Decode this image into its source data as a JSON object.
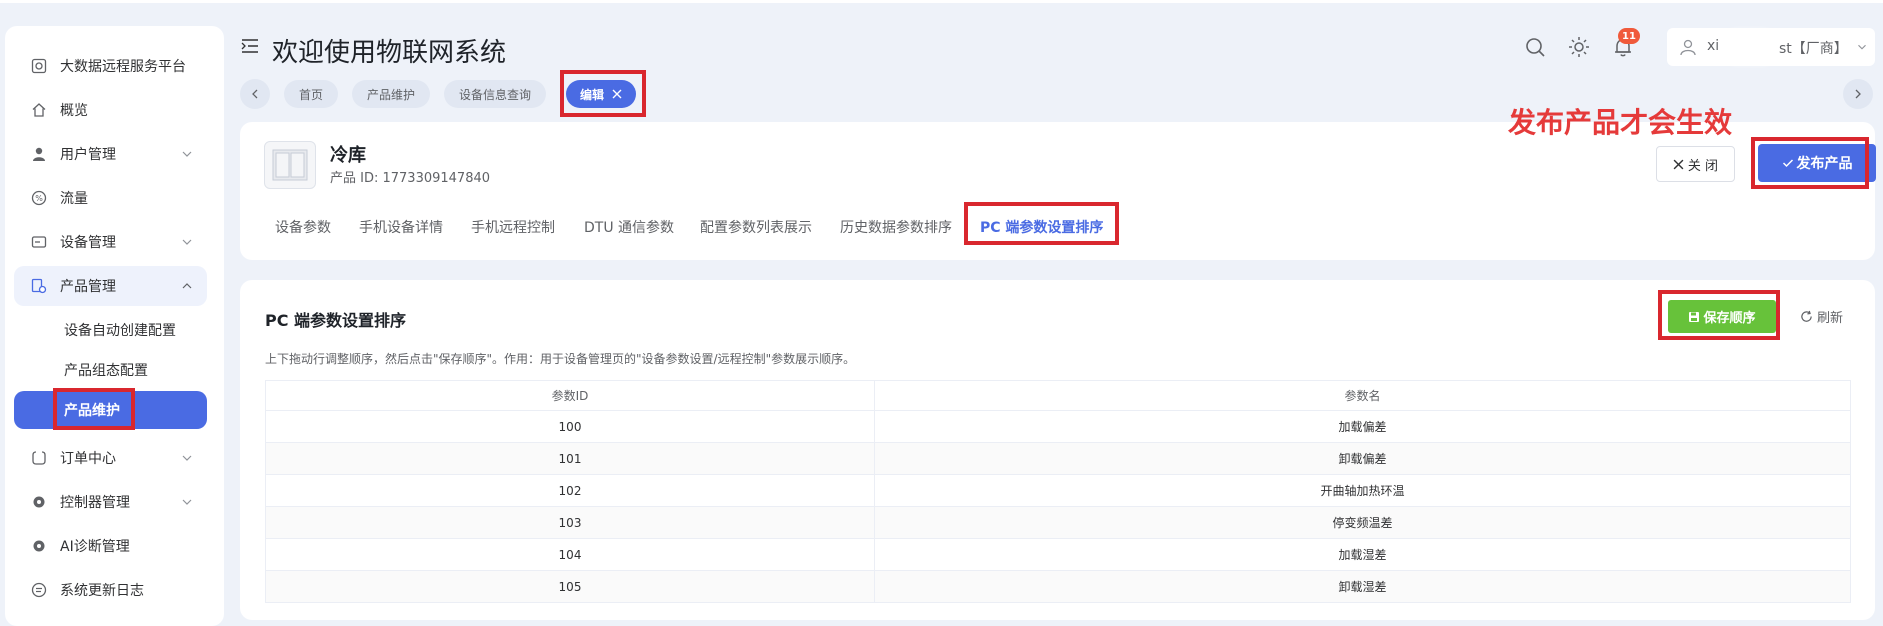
{
  "header": {
    "title": "欢迎使用物联网系统",
    "notification_count": "11",
    "user_name_start": "xi",
    "user_name_end": "st【厂商】"
  },
  "sidebar": {
    "items": [
      {
        "label": "大数据远程服务平台",
        "icon": "platform-icon"
      },
      {
        "label": "概览",
        "icon": "home-icon"
      },
      {
        "label": "用户管理",
        "icon": "user-icon"
      },
      {
        "label": "流量",
        "icon": "percent-icon"
      },
      {
        "label": "设备管理",
        "icon": "device-icon"
      },
      {
        "label": "产品管理",
        "icon": "product-icon"
      },
      {
        "label": "订单中心",
        "icon": "order-icon"
      },
      {
        "label": "控制器管理",
        "icon": "gear-icon"
      },
      {
        "label": "AI诊断管理",
        "icon": "gear-icon"
      },
      {
        "label": "系统更新日志",
        "icon": "log-icon"
      }
    ],
    "product_sub": [
      "设备自动创建配置",
      "产品组态配置",
      "产品维护"
    ]
  },
  "tabs": [
    {
      "label": "首页"
    },
    {
      "label": "产品维护"
    },
    {
      "label": "设备信息查询"
    },
    {
      "label": "编辑"
    }
  ],
  "product": {
    "name": "冷库",
    "id_text": "产品 ID:  1773309147840",
    "close_label": "关 闭",
    "publish_label": "发布产品",
    "notice": "发布产品才会生效"
  },
  "subtabs": [
    "设备参数",
    "手机设备详情",
    "手机远程控制",
    "DTU 通信参数",
    "配置参数列表展示",
    "历史数据参数排序",
    "PC 端参数设置排序"
  ],
  "section": {
    "title": "PC 端参数设置排序",
    "description": "上下拖动行调整顺序，然后点击\"保存顺序\"。作用：用于设备管理页的\"设备参数设置/远程控制\"参数展示顺序。",
    "save_label": "保存顺序",
    "refresh_label": "刷新"
  },
  "table": {
    "headers": [
      "参数ID",
      "参数名"
    ],
    "rows": [
      [
        "100",
        "加载偏差"
      ],
      [
        "101",
        "卸载偏差"
      ],
      [
        "102",
        "开曲轴加热环温"
      ],
      [
        "103",
        "停变频温差"
      ],
      [
        "104",
        "加载湿差"
      ],
      [
        "105",
        "卸载湿差"
      ]
    ]
  },
  "colors": {
    "accent": "#4a6be3",
    "save_green": "#67c23a",
    "highlight_red": "#d9272e",
    "notice_red": "#e53a3a",
    "badge": "#f05a3b",
    "background": "#eef2f9"
  }
}
